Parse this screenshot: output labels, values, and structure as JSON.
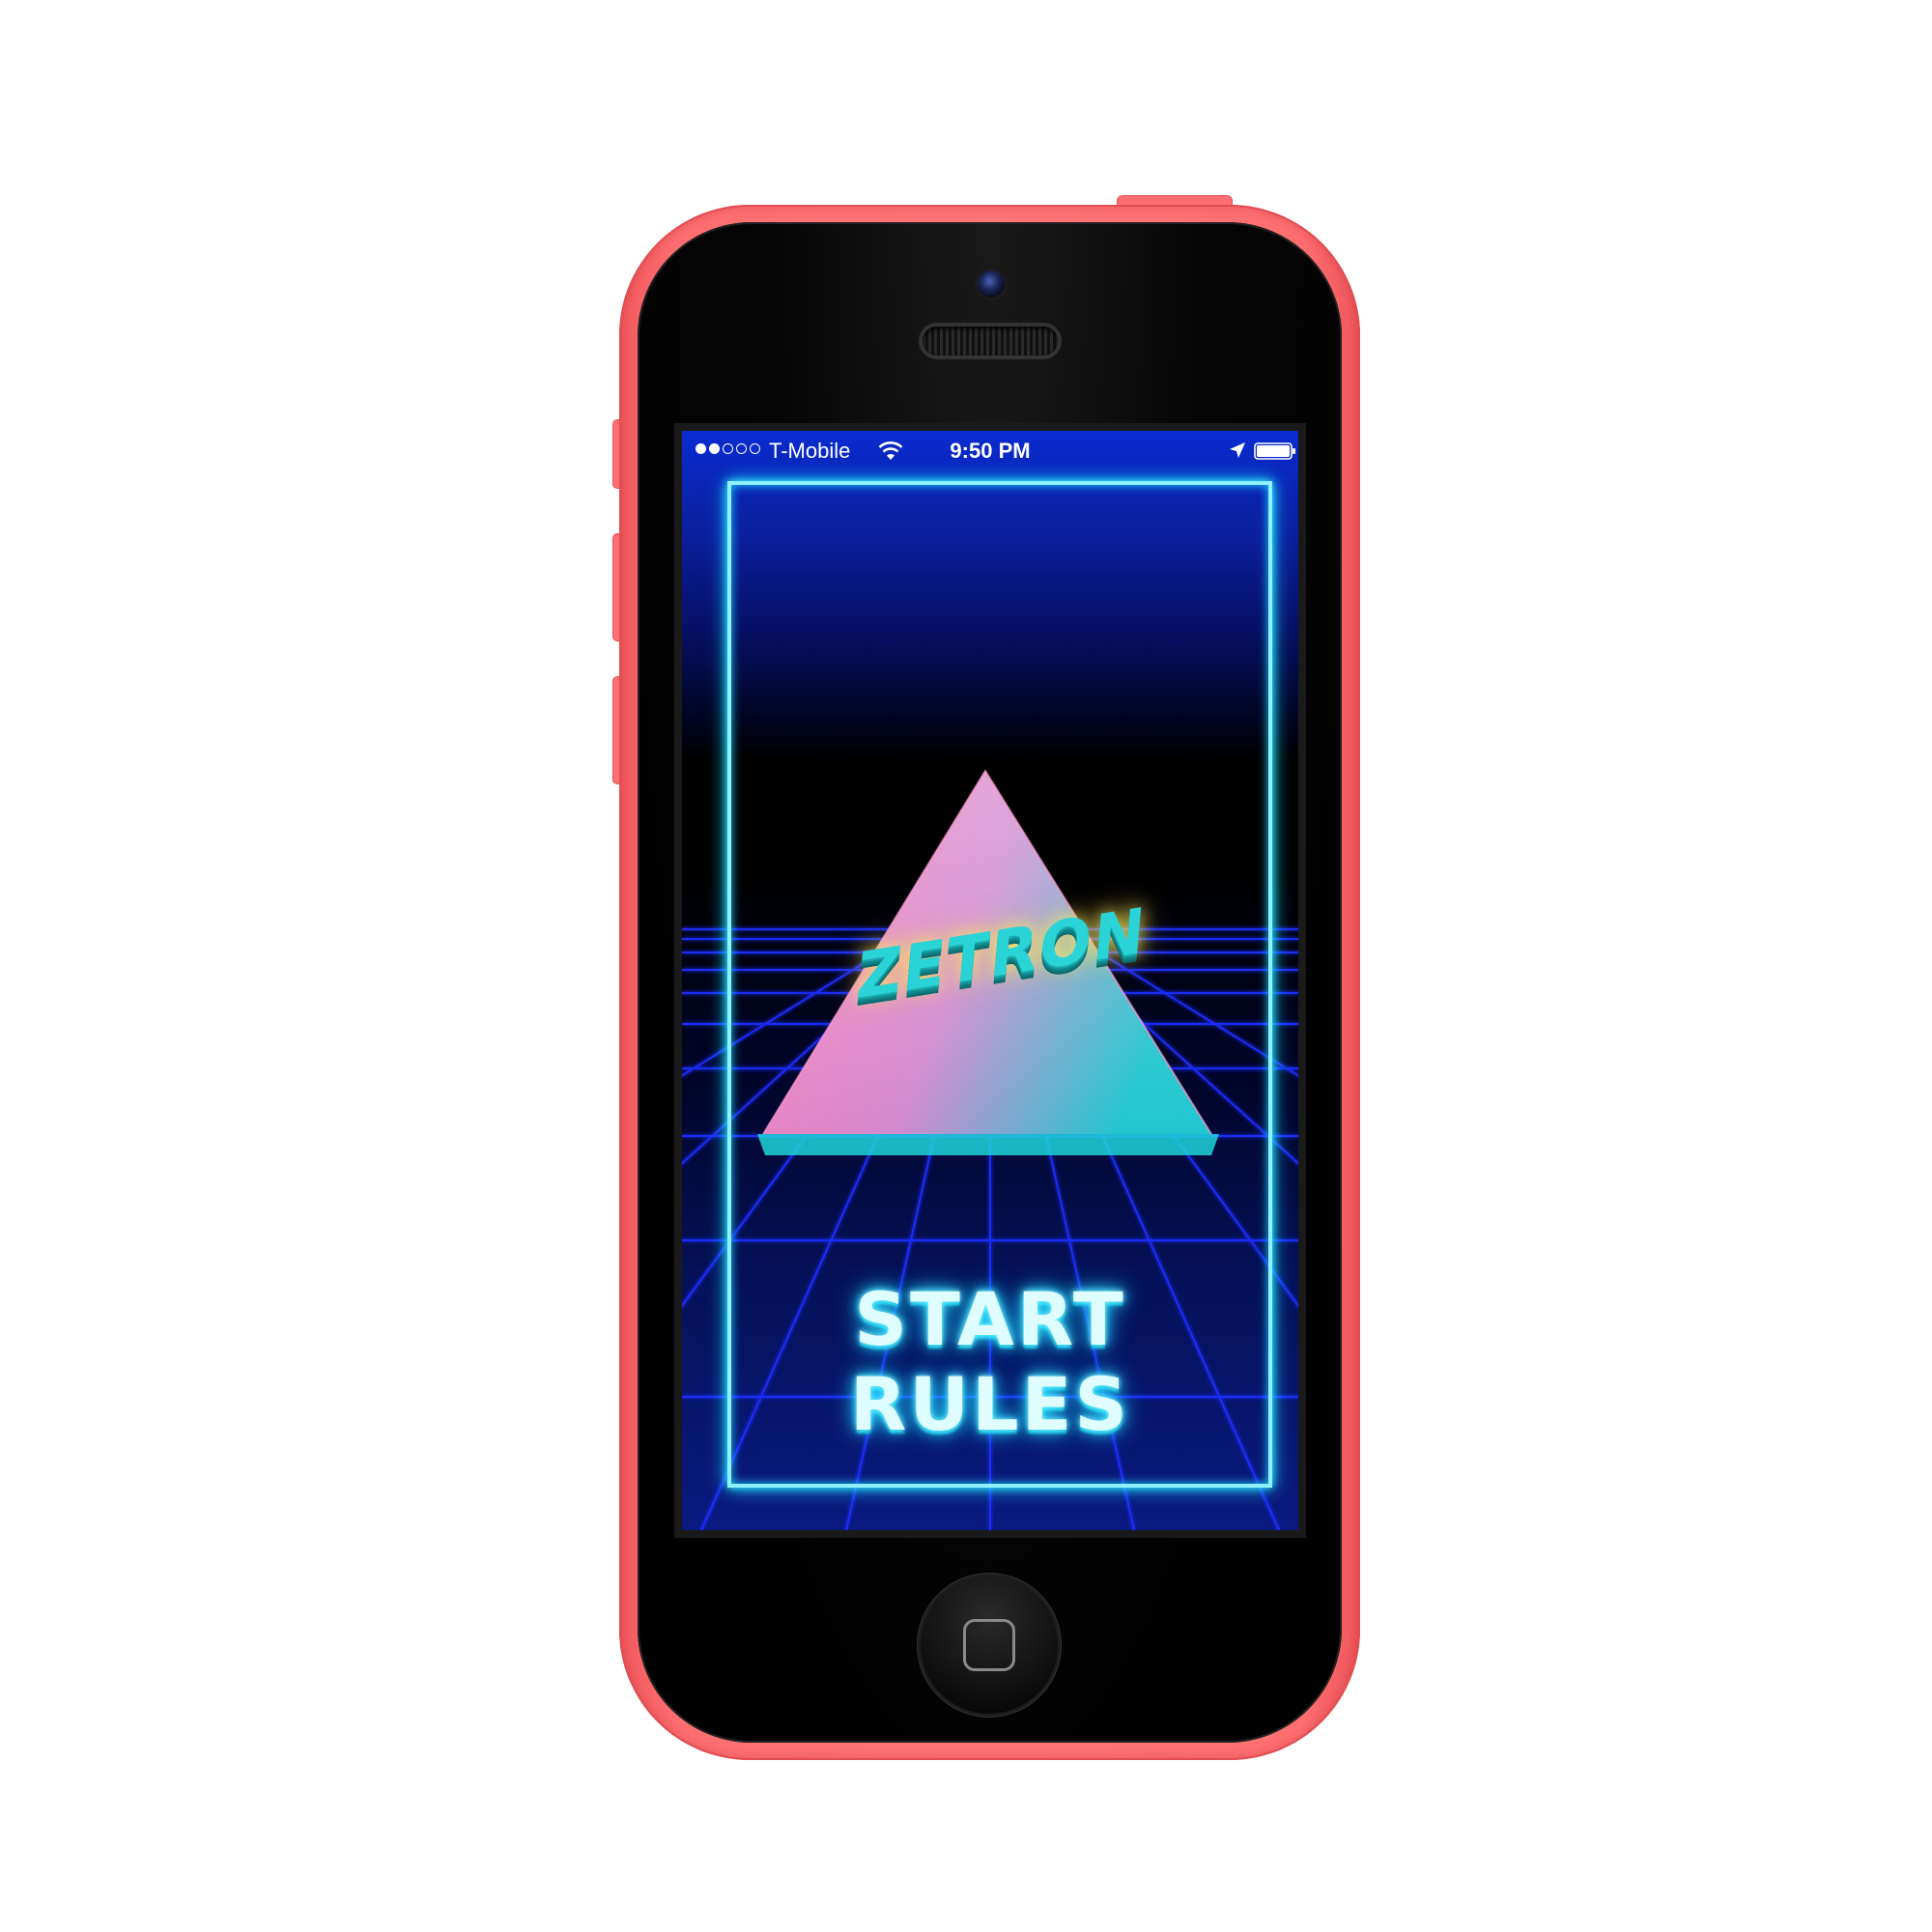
{
  "device": {
    "model": "iPhone 5c",
    "shell_color": "#ff7477"
  },
  "status_bar": {
    "signal_bars_filled": 2,
    "signal_bars_total": 5,
    "carrier": "T-Mobile",
    "time": "9:50 PM",
    "icons": [
      "wifi-icon",
      "location-arrow-icon",
      "battery-icon"
    ]
  },
  "game": {
    "logo_text": "ZETRON",
    "menu": {
      "start_label": "START",
      "rules_label": "RULES"
    }
  },
  "colors": {
    "neon_cyan": "#2ee8ff",
    "grid_blue": "#1a2cff",
    "triangle_pink": "#ff7fb8",
    "triangle_teal": "#22c9cf",
    "logo_teal": "#2ad3d6"
  }
}
